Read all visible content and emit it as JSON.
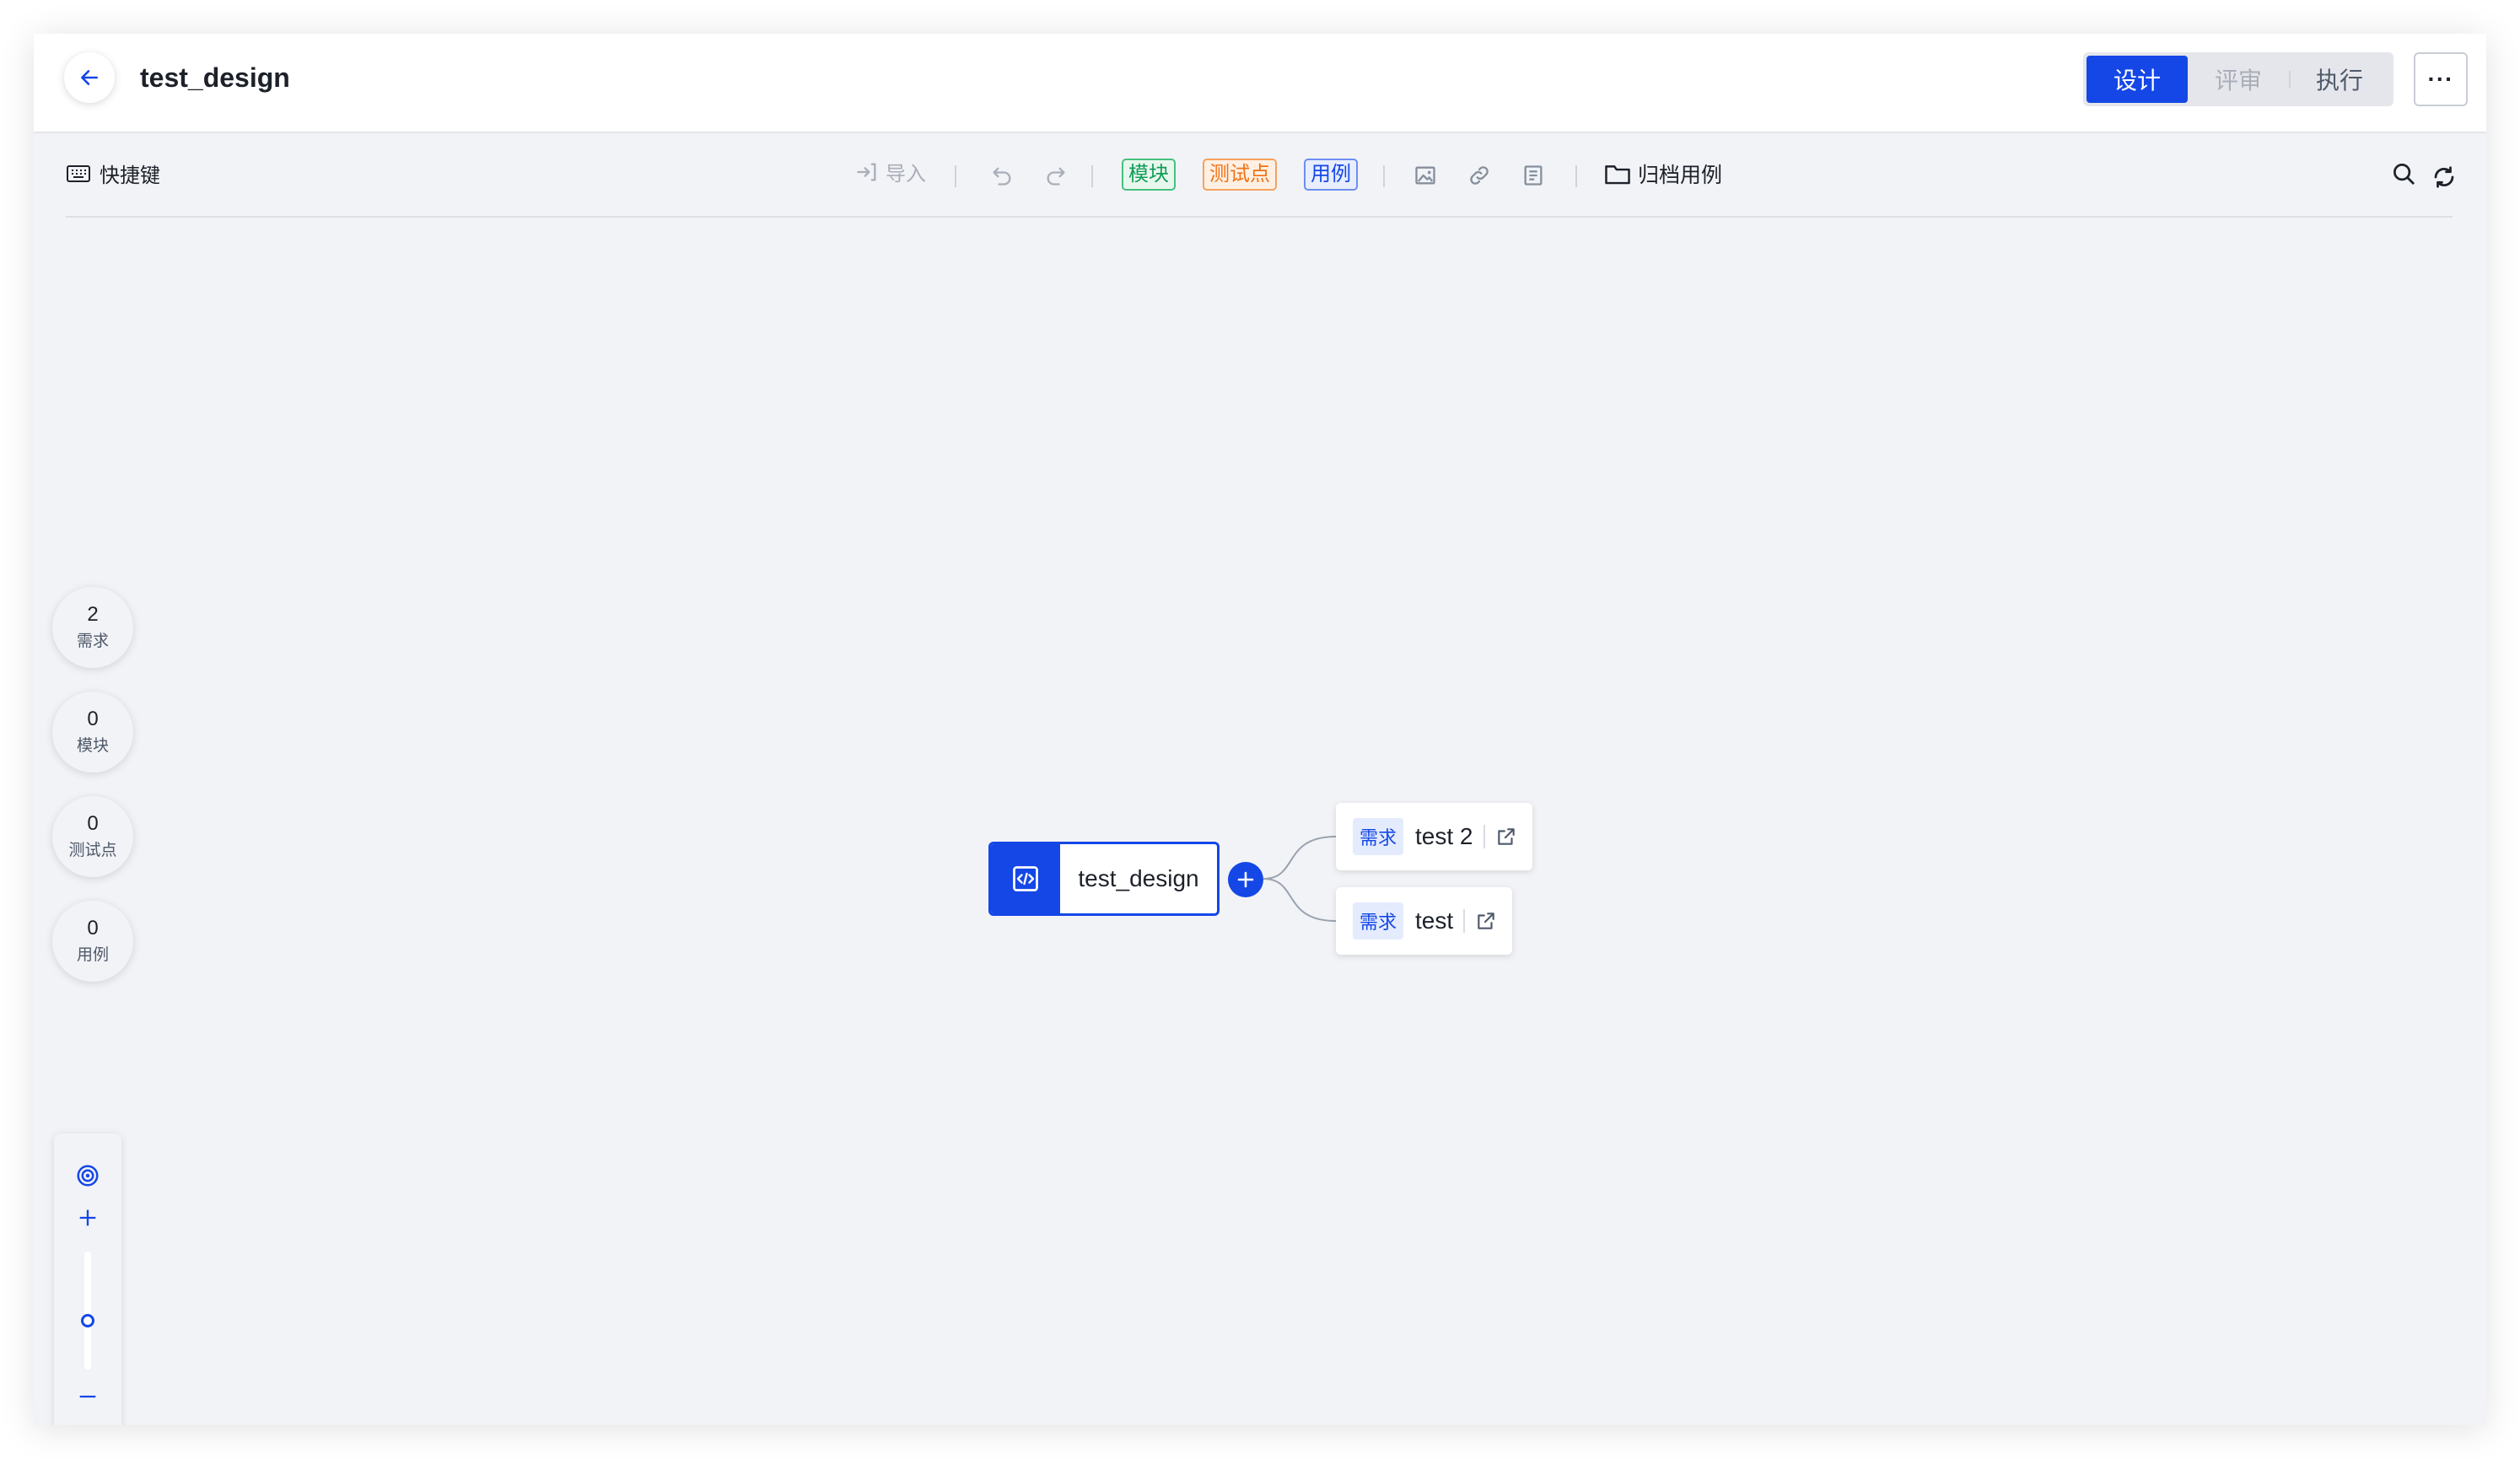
{
  "header": {
    "title": "test_design",
    "modes": [
      {
        "label": "设计",
        "state": "active"
      },
      {
        "label": "评审",
        "state": "disabled"
      },
      {
        "label": "执行",
        "state": "normal"
      }
    ],
    "more_label": "···"
  },
  "toolbar": {
    "shortcut_label": "快捷键",
    "import_label": "导入",
    "tags": {
      "module": "模块",
      "testpoint": "测试点",
      "case": "用例"
    },
    "archive_label": "归档用例"
  },
  "stats": [
    {
      "count": "2",
      "label": "需求"
    },
    {
      "count": "0",
      "label": "模块"
    },
    {
      "count": "0",
      "label": "测试点"
    },
    {
      "count": "0",
      "label": "用例"
    }
  ],
  "zoom": {
    "level": 0.4
  },
  "mindmap": {
    "root": {
      "label": "test_design"
    },
    "children": [
      {
        "tag": "需求",
        "label": "test 2"
      },
      {
        "tag": "需求",
        "label": "test"
      }
    ]
  },
  "colors": {
    "accent": "#1447e6",
    "canvas": "#f2f3f7"
  }
}
